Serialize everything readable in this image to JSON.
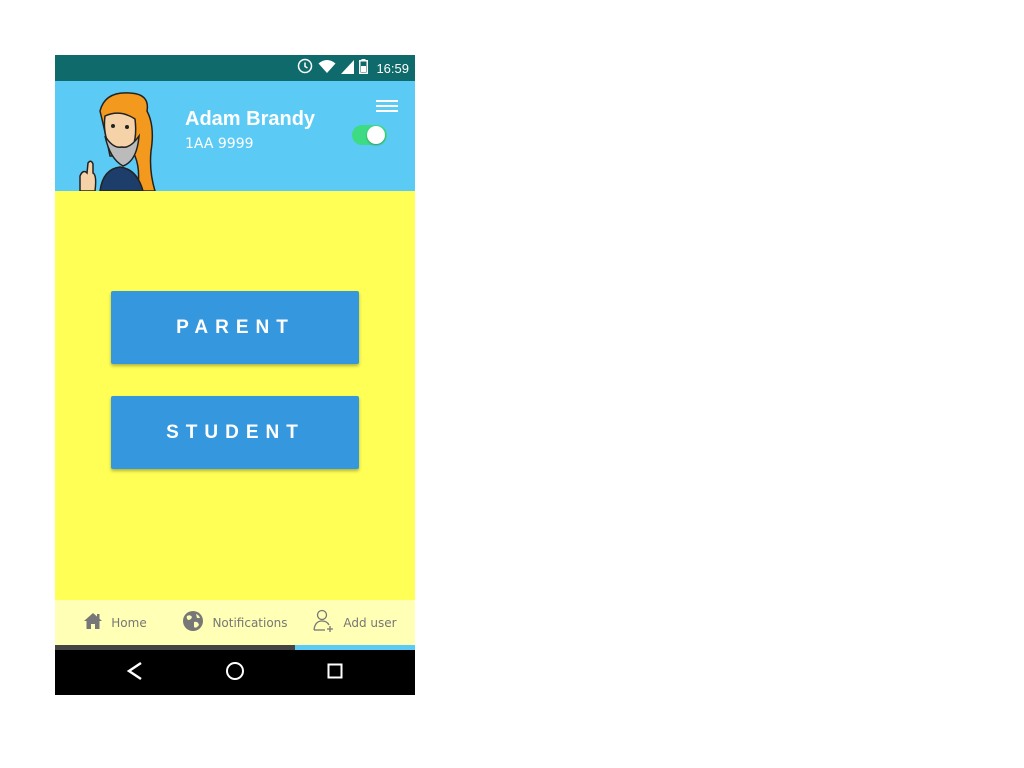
{
  "status_bar": {
    "time": "16:59",
    "icons": [
      "alarm-icon",
      "wifi-icon",
      "signal-icon",
      "battery-icon"
    ]
  },
  "header": {
    "user_name": "Adam Brandy",
    "user_id": "1AA 9999",
    "toggle_on": true
  },
  "main": {
    "buttons": [
      {
        "label": "PARENT"
      },
      {
        "label": "STUDENT"
      }
    ]
  },
  "tabs": [
    {
      "label": "Home",
      "icon": "home-icon"
    },
    {
      "label": "Notifications",
      "icon": "globe-icon"
    },
    {
      "label": "Add user",
      "icon": "add-user-icon",
      "active": true
    }
  ],
  "colors": {
    "status_bar": "#0f6b6b",
    "header": "#5bcbf5",
    "background": "#ffff55",
    "button": "#3597dd",
    "tab_bar": "#ffffb5",
    "toggle": "#3ddc84"
  }
}
